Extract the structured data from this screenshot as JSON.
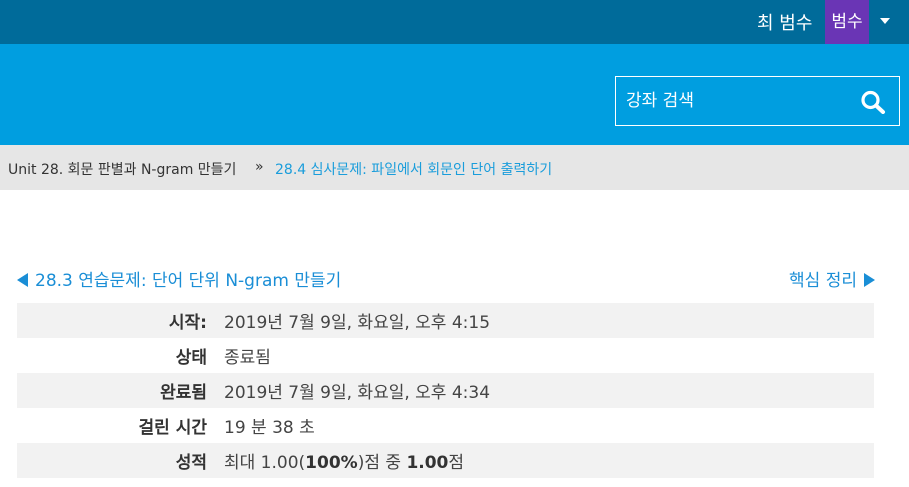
{
  "header": {
    "user_name": "최 범수",
    "avatar_text": "범수"
  },
  "search": {
    "placeholder": "강좌 검색"
  },
  "breadcrumb": {
    "items": [
      "Unit 28. 회문 판별과 N-gram 만들기",
      "28.4 심사문제: 파일에서 회문인 단어 출력하기"
    ],
    "separator": "»"
  },
  "navigation": {
    "prev_label": "28.3 연습문제: 단어 단위 N-gram 만들기",
    "next_label": "핵심 정리"
  },
  "summary": {
    "rows": [
      {
        "label": "시작:",
        "value": "2019년 7월 9일, 화요일, 오후 4:15"
      },
      {
        "label": "상태",
        "value": "종료됨"
      },
      {
        "label": "완료됨",
        "value": "2019년 7월 9일, 화요일, 오후 4:34"
      },
      {
        "label": "걸린 시간",
        "value": "19 분 38 초"
      },
      {
        "label": "성적",
        "value_parts": [
          "최대 1.00(",
          "100%",
          ")점 중 ",
          "1.00",
          "점"
        ]
      }
    ]
  },
  "colors": {
    "topbar": "#006b9a",
    "banner": "#009ee0",
    "avatar": "#6a35b5",
    "link": "#1a8ed6"
  }
}
